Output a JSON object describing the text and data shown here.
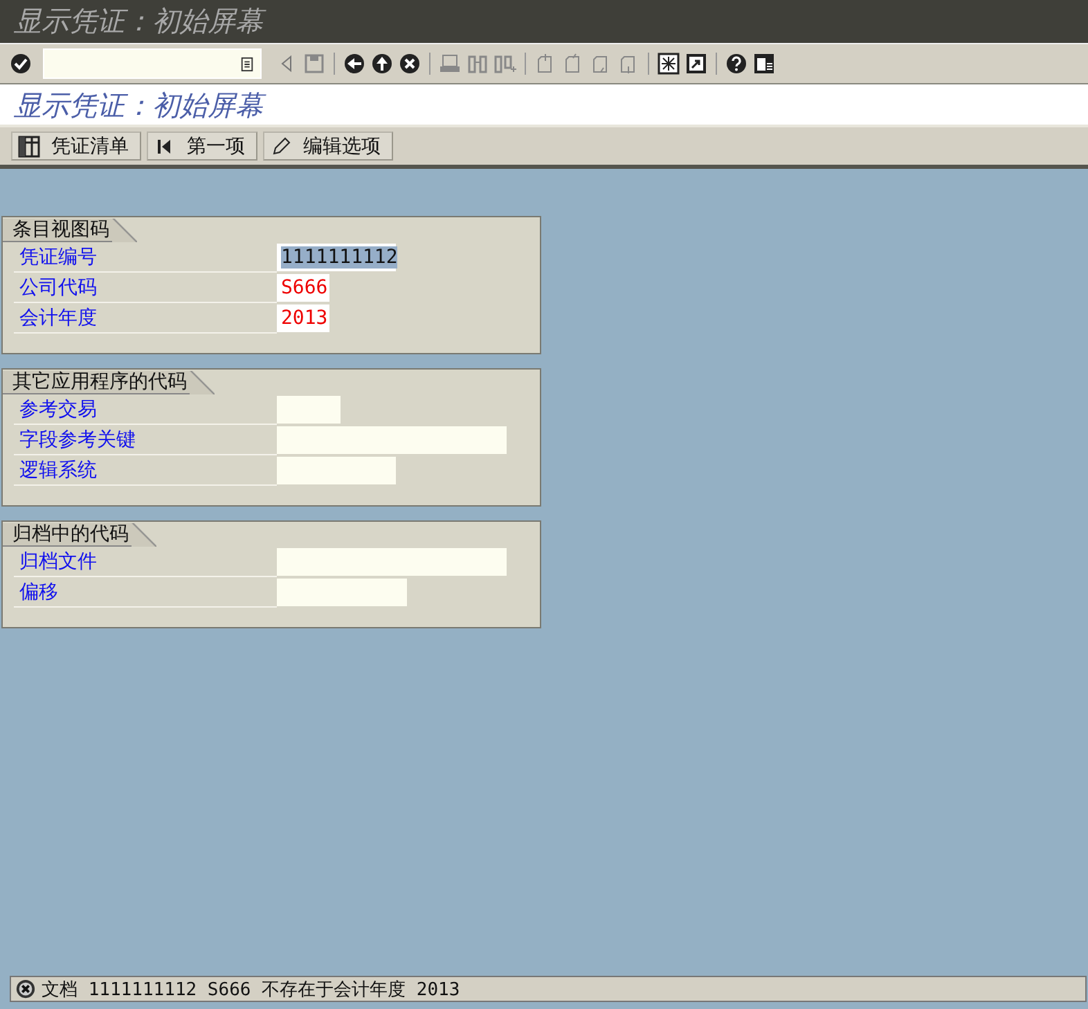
{
  "window": {
    "title": "显示凭证：初始屏幕"
  },
  "screen_title": "显示凭证：初始屏幕",
  "app_toolbar": [
    {
      "kind": "list",
      "label": "凭证清单"
    },
    {
      "kind": "first",
      "label": "第一项"
    },
    {
      "kind": "edit",
      "label": "编辑选项"
    }
  ],
  "groups": [
    {
      "title": "条目视图码",
      "fields": [
        {
          "label": "凭证编号",
          "value": "1111111112",
          "highlighted": true,
          "error": false
        },
        {
          "label": "公司代码",
          "value": "S666",
          "highlighted": false,
          "error": true
        },
        {
          "label": "会计年度",
          "value": "2013",
          "highlighted": false,
          "error": true
        }
      ]
    },
    {
      "title": "其它应用程序的代码",
      "fields": [
        {
          "label": "参考交易"
        },
        {
          "label": "字段参考关键"
        },
        {
          "label": "逻辑系统"
        }
      ]
    },
    {
      "title": "归档中的代码",
      "fields": [
        {
          "label": "归档文件"
        },
        {
          "label": "偏移"
        }
      ]
    }
  ],
  "status_bar": {
    "kind": "error",
    "message": "文档 1111111112 S666 不存在于会计年度 2013"
  }
}
